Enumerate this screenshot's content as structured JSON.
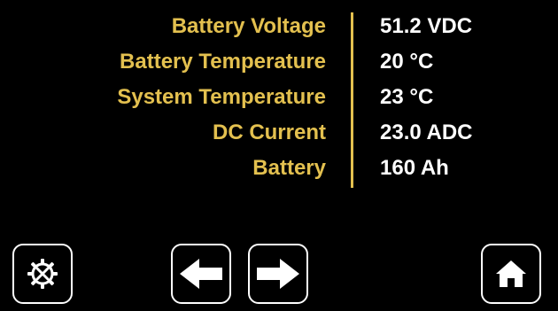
{
  "readings": [
    {
      "label": "Battery Voltage",
      "value": "51.2 VDC"
    },
    {
      "label": "Battery Temperature",
      "value": "20 °C"
    },
    {
      "label": "System Temperature",
      "value": "23 °C"
    },
    {
      "label": "DC Current",
      "value": "23.0 ADC"
    },
    {
      "label": "Battery",
      "value": "160 Ah"
    }
  ],
  "buttons": {
    "settings_icon": "gear-wrench-icon",
    "back_icon": "arrow-left-icon",
    "forward_icon": "arrow-right-icon",
    "home_icon": "home-icon"
  },
  "colors": {
    "background": "#000000",
    "label": "#e3c04f",
    "value": "#ffffff",
    "divider": "#e3c04f",
    "button_border": "#ffffff"
  }
}
